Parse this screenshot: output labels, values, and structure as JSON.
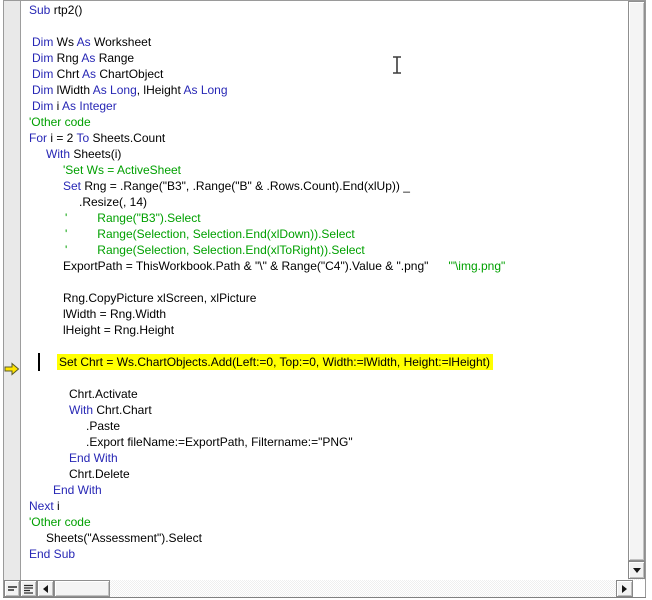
{
  "editor": {
    "colors": {
      "keyword": "#2727b5",
      "comment": "#00a000",
      "normal": "#000000",
      "highlight_background": "#ffff00",
      "highlight_text": "#000000",
      "execution_arrow_fill": "#ffe400",
      "margin_background": "#e9e9e9"
    },
    "lines": [
      {
        "indent": 8,
        "segments": [
          {
            "type": "keyword",
            "text": "Sub"
          },
          {
            "type": "normal",
            "text": " rtp2()"
          }
        ]
      },
      {
        "indent": 8,
        "segments": []
      },
      {
        "indent": 11,
        "segments": [
          {
            "type": "keyword",
            "text": "Dim"
          },
          {
            "type": "normal",
            "text": " Ws "
          },
          {
            "type": "keyword",
            "text": "As"
          },
          {
            "type": "normal",
            "text": " Worksheet"
          }
        ]
      },
      {
        "indent": 11,
        "segments": [
          {
            "type": "keyword",
            "text": "Dim"
          },
          {
            "type": "normal",
            "text": " Rng "
          },
          {
            "type": "keyword",
            "text": "As"
          },
          {
            "type": "normal",
            "text": " Range"
          }
        ]
      },
      {
        "indent": 11,
        "segments": [
          {
            "type": "keyword",
            "text": "Dim"
          },
          {
            "type": "normal",
            "text": " Chrt "
          },
          {
            "type": "keyword",
            "text": "As"
          },
          {
            "type": "normal",
            "text": " ChartObject"
          }
        ]
      },
      {
        "indent": 11,
        "segments": [
          {
            "type": "keyword",
            "text": "Dim"
          },
          {
            "type": "normal",
            "text": " lWidth "
          },
          {
            "type": "keyword",
            "text": "As"
          },
          {
            "type": "normal",
            "text": " "
          },
          {
            "type": "keyword",
            "text": "Long"
          },
          {
            "type": "normal",
            "text": ", lHeight "
          },
          {
            "type": "keyword",
            "text": "As"
          },
          {
            "type": "normal",
            "text": " "
          },
          {
            "type": "keyword",
            "text": "Long"
          }
        ]
      },
      {
        "indent": 11,
        "segments": [
          {
            "type": "keyword",
            "text": "Dim"
          },
          {
            "type": "normal",
            "text": " i "
          },
          {
            "type": "keyword",
            "text": "As"
          },
          {
            "type": "normal",
            "text": " "
          },
          {
            "type": "keyword",
            "text": "Integer"
          }
        ]
      },
      {
        "indent": 8,
        "segments": [
          {
            "type": "comment",
            "text": "'Other code"
          }
        ]
      },
      {
        "indent": 8,
        "segments": [
          {
            "type": "keyword",
            "text": "For"
          },
          {
            "type": "normal",
            "text": " i = 2 "
          },
          {
            "type": "keyword",
            "text": "To"
          },
          {
            "type": "normal",
            "text": " Sheets.Count"
          }
        ]
      },
      {
        "indent": 25,
        "segments": [
          {
            "type": "keyword",
            "text": "With"
          },
          {
            "type": "normal",
            "text": " Sheets(i)"
          }
        ]
      },
      {
        "indent": 42,
        "segments": [
          {
            "type": "comment",
            "text": "'Set Ws = ActiveSheet"
          }
        ]
      },
      {
        "indent": 42,
        "segments": [
          {
            "type": "keyword",
            "text": "Set"
          },
          {
            "type": "normal",
            "text": " Rng = .Range(\"B3\", .Range(\"B\" & .Rows.Count).End(xlUp)) _"
          }
        ]
      },
      {
        "indent": 58,
        "segments": [
          {
            "type": "normal",
            "text": ".Resize(, 14)"
          }
        ]
      },
      {
        "indent": 44,
        "segments": [
          {
            "type": "comment",
            "text": "'         Range(\"B3\").Select"
          }
        ]
      },
      {
        "indent": 44,
        "segments": [
          {
            "type": "comment",
            "text": "'         Range(Selection, Selection.End(xlDown)).Select"
          }
        ]
      },
      {
        "indent": 44,
        "segments": [
          {
            "type": "comment",
            "text": "'         Range(Selection, Selection.End(xlToRight)).Select"
          }
        ]
      },
      {
        "indent": 42,
        "segments": [
          {
            "type": "normal",
            "text": "ExportPath = ThisWorkbook.Path & \"\\\" & Range(\"C4\").Value & \".png\""
          },
          {
            "type": "comment",
            "text": "      '\"\\img.png\""
          }
        ]
      },
      {
        "indent": 42,
        "segments": []
      },
      {
        "indent": 42,
        "segments": [
          {
            "type": "normal",
            "text": "Rng.CopyPicture xlScreen, xlPicture"
          }
        ]
      },
      {
        "indent": 42,
        "segments": [
          {
            "type": "normal",
            "text": "lWidth = Rng.Width"
          }
        ]
      },
      {
        "indent": 42,
        "segments": [
          {
            "type": "normal",
            "text": "lHeight = Rng.Height"
          }
        ]
      },
      {
        "indent": 42,
        "segments": []
      },
      {
        "indent": 36,
        "highlight": true,
        "segments": [
          {
            "type": "normal",
            "text": "Set Chrt = Ws.ChartObjects.Add(Left:=0, Top:=0, Width:=lWidth, Height:=lHeight)"
          }
        ]
      },
      {
        "indent": 36,
        "segments": []
      },
      {
        "indent": 48,
        "segments": [
          {
            "type": "normal",
            "text": "Chrt.Activate"
          }
        ]
      },
      {
        "indent": 48,
        "segments": [
          {
            "type": "keyword",
            "text": "With"
          },
          {
            "type": "normal",
            "text": " Chrt.Chart"
          }
        ]
      },
      {
        "indent": 65,
        "segments": [
          {
            "type": "normal",
            "text": ".Paste"
          }
        ]
      },
      {
        "indent": 65,
        "segments": [
          {
            "type": "normal",
            "text": ".Export fileName:=ExportPath, Filtername:=\"PNG\""
          }
        ]
      },
      {
        "indent": 48,
        "segments": [
          {
            "type": "keyword",
            "text": "End With"
          }
        ]
      },
      {
        "indent": 48,
        "segments": [
          {
            "type": "normal",
            "text": "Chrt.Delete"
          }
        ]
      },
      {
        "indent": 32,
        "segments": [
          {
            "type": "keyword",
            "text": "End With"
          }
        ]
      },
      {
        "indent": 8,
        "segments": [
          {
            "type": "keyword",
            "text": "Next"
          },
          {
            "type": "normal",
            "text": " i"
          }
        ]
      },
      {
        "indent": 8,
        "segments": [
          {
            "type": "comment",
            "text": "'Other code"
          }
        ]
      },
      {
        "indent": 25,
        "segments": [
          {
            "type": "normal",
            "text": "Sheets(\"Assessment\").Select"
          }
        ]
      },
      {
        "indent": 8,
        "segments": [
          {
            "type": "keyword",
            "text": "End Sub"
          }
        ]
      }
    ]
  },
  "icons": {
    "execution-arrow-icon": "yellow right arrow marking current statement",
    "ibeam-cursor-icon": "text I-beam mouse pointer",
    "down-arrow-icon": "▼",
    "left-arrow-icon": "◄",
    "right-arrow-icon": "►",
    "procedure-view-icon": "short line group",
    "full-module-view-icon": "full line group"
  }
}
